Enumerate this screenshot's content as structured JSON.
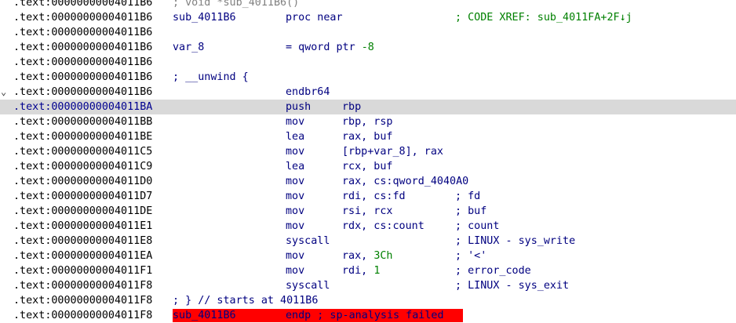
{
  "segment": ".text",
  "rows": [
    {
      "addr": "00000000004011B6",
      "text": "; void *sub_4011B6()"
    },
    {
      "addr": "00000000004011B6",
      "label": "sub_4011B6",
      "mnemonic": "proc near",
      "xref": "; CODE XREF: sub_4011FA+2F↓j"
    },
    {
      "addr": "00000000004011B6"
    },
    {
      "addr": "00000000004011B6",
      "label": "var_8",
      "eq": "= qword ptr -8"
    },
    {
      "addr": "00000000004011B6"
    },
    {
      "addr": "00000000004011B6",
      "text": "; __unwind {"
    },
    {
      "addr": "00000000004011B6",
      "chevron": "⌄",
      "mnemonic": "endbr64"
    },
    {
      "addr": "00000000004011BA",
      "mnemonic": "push",
      "operands": "rbp",
      "selected": true
    },
    {
      "addr": "00000000004011BB",
      "mnemonic": "mov",
      "operands": "rbp, rsp"
    },
    {
      "addr": "00000000004011BE",
      "mnemonic": "lea",
      "operands": "rax, buf"
    },
    {
      "addr": "00000000004011C5",
      "mnemonic": "mov",
      "operands": "[rbp+var_8], rax"
    },
    {
      "addr": "00000000004011C9",
      "mnemonic": "lea",
      "operands": "rcx, buf"
    },
    {
      "addr": "00000000004011D0",
      "mnemonic": "mov",
      "operands": "rax, cs:qword_4040A0"
    },
    {
      "addr": "00000000004011D7",
      "mnemonic": "mov",
      "operands": "rdi, cs:fd",
      "comment": "; fd"
    },
    {
      "addr": "00000000004011DE",
      "mnemonic": "mov",
      "operands": "rsi, rcx",
      "comment": "; buf"
    },
    {
      "addr": "00000000004011E1",
      "mnemonic": "mov",
      "operands": "rdx, cs:count",
      "comment": "; count"
    },
    {
      "addr": "00000000004011E8",
      "mnemonic": "syscall",
      "comment": "; LINUX - sys_write"
    },
    {
      "addr": "00000000004011EA",
      "mnemonic": "mov",
      "operands": "rax, 3Ch",
      "comment": "; '<'"
    },
    {
      "addr": "00000000004011F1",
      "mnemonic": "mov",
      "operands": "rdi, 1",
      "comment": "; error_code"
    },
    {
      "addr": "00000000004011F8",
      "mnemonic": "syscall",
      "comment": "; LINUX - sys_exit"
    },
    {
      "addr": "00000000004011F8",
      "text": "; } // starts at 4011B6"
    },
    {
      "addr": "00000000004011F8",
      "error_label": "sub_4011B6",
      "error_text": "endp ; sp-analysis failed"
    }
  ],
  "colors": {
    "background": "#ffffff",
    "selection": "#d9d9d9",
    "error_bg": "#ff0000",
    "code_blue": "#000080",
    "comment_gray": "#808080",
    "xref_green": "#008000"
  }
}
